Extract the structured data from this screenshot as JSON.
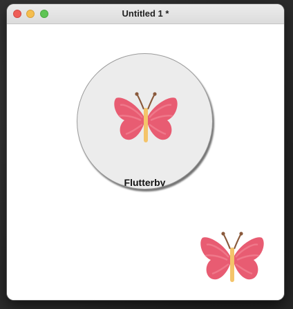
{
  "window": {
    "title": "Untitled 1 *"
  },
  "main": {
    "button": {
      "label": "Flutterby",
      "icon": "butterfly-icon"
    },
    "image": {
      "icon": "butterfly-icon"
    }
  },
  "colors": {
    "wing": "#e85c72",
    "wing_inner": "#f08090",
    "body": "#f4c46a",
    "antenna": "#8a5a3c"
  }
}
